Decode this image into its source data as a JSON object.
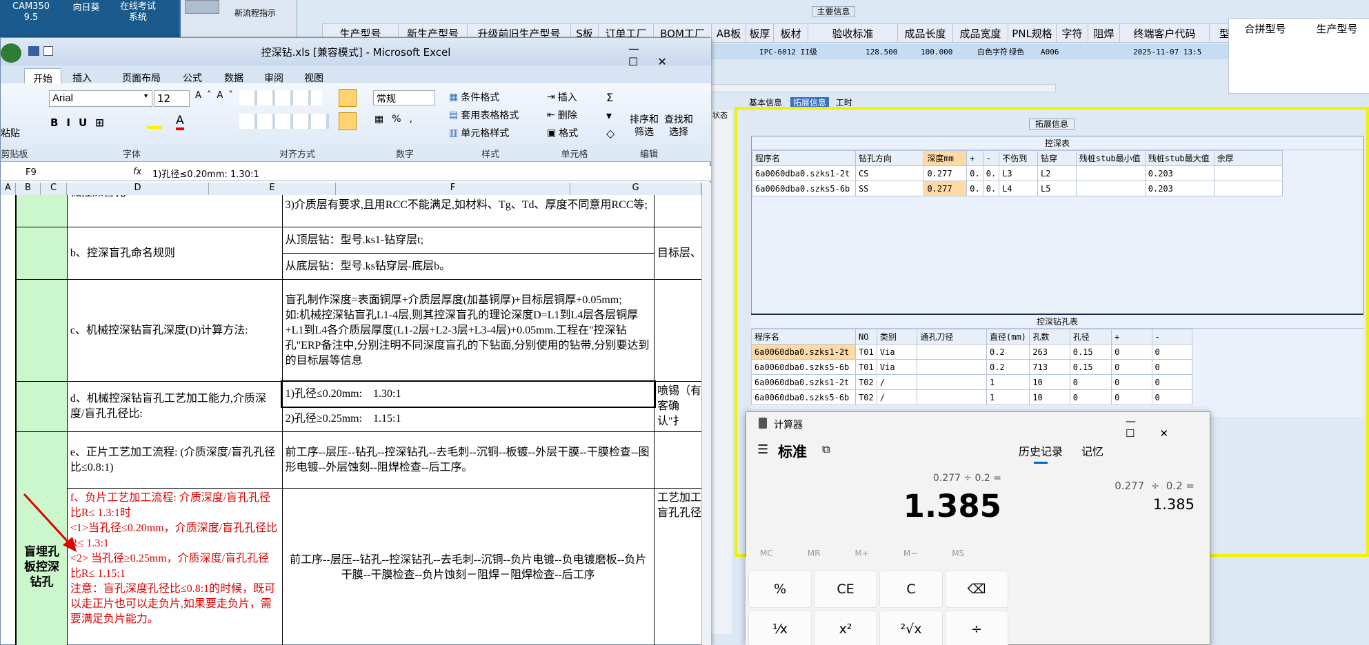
{
  "desktop": {
    "icons": [
      {
        "label": "CAM350\n9.5"
      },
      {
        "label": "向日葵"
      },
      {
        "label": "在线考试\n系统"
      }
    ],
    "new_flow_label": "新流程指示"
  },
  "erp": {
    "main_group": "主要信息",
    "headers": [
      "生产型号",
      "新生产型号",
      "升级前旧生产型号",
      "S板",
      "订单工厂",
      "BOM工厂",
      "AB板",
      "板厚",
      "板材",
      "验收标准",
      "成品长度",
      "成品宽度",
      "PNL规格",
      "字符",
      "阻焊",
      "终端客户代码",
      "型号创"
    ],
    "values": [
      "IPC-6012 II级",
      "128.500",
      "100.000",
      "白色字符",
      "绿色",
      "A006",
      "2025-11-07 13:5"
    ],
    "right_headers": [
      "合拼型号",
      "生产型号"
    ],
    "tabs": [
      "基本信息",
      "拓展信息",
      "工时"
    ],
    "side_label": "状态"
  },
  "panel": {
    "title": "拓展信息",
    "table1": {
      "caption": "控深表",
      "headers": [
        "程序名",
        "钻孔方向",
        "深度mm",
        "+",
        "-",
        "不伤到",
        "钻穿",
        "残桩stub最小值",
        "残桩stub最大值",
        "余厚"
      ],
      "rows": [
        [
          "6a0060dba0.szks1-2t",
          "CS",
          "0.277",
          "0.",
          "0.",
          "L3",
          "L2",
          "",
          "0.203",
          ""
        ],
        [
          "6a0060dba0.szks5-6b",
          "SS",
          "0.277",
          "0.",
          "0.",
          "L4",
          "L5",
          "",
          "0.203",
          ""
        ]
      ]
    },
    "table2": {
      "caption": "控深钻孔表",
      "headers": [
        "程序名",
        "NO",
        "类别",
        "通孔刀径",
        "直径(mm)",
        "孔数",
        "孔径",
        "+",
        "-"
      ],
      "rows": [
        [
          "6a0060dba0.szks1-2t",
          "T01",
          "Via",
          "",
          "0.2",
          "263",
          "0.15",
          "0",
          "0"
        ],
        [
          "6a0060dba0.szks5-6b",
          "T01",
          "Via",
          "",
          "0.2",
          "713",
          "0.15",
          "0",
          "0"
        ],
        [
          "6a0060dba0.szks1-2t",
          "T02",
          "/",
          "",
          "1",
          "10",
          "0",
          "0",
          "0"
        ],
        [
          "6a0060dba0.szks5-6b",
          "T02",
          "/",
          "",
          "1",
          "10",
          "0",
          "0",
          "0"
        ]
      ]
    }
  },
  "excel": {
    "title": "控深钻.xls  [兼容模式] - Microsoft Excel",
    "tabs": [
      "开始",
      "插入",
      "页面布局",
      "公式",
      "数据",
      "审阅",
      "视图"
    ],
    "clipboard": {
      "paste": "粘贴",
      "label": "剪贴板"
    },
    "font": {
      "name": "Arial",
      "size": "12",
      "label": "字体"
    },
    "align_label": "对齐方式",
    "number": {
      "format": "常规",
      "label": "数字"
    },
    "styles": {
      "cond": "条件格式",
      "table": "套用表格格式",
      "cell": "单元格样式",
      "label": "样式"
    },
    "cells": {
      "insert": "插入",
      "delete": "删除",
      "format": "格式",
      "label": "单元格"
    },
    "edit": {
      "sort": "排序和\n筛选",
      "find": "查找和\n选择",
      "label": "编辑"
    },
    "name_box": "F9",
    "formula": "1)孔径≤0.20mm:    1.30:1",
    "columns": [
      "A",
      "B",
      "C",
      "D",
      "E",
      "F",
      "G"
    ],
    "rows": [
      {
        "d": "械控深盲孔",
        "f": "3)介质层有要求,且用RCC不能满足,如材料、Tg、Td、厚度不同意用RCC等;",
        "g": ""
      },
      {
        "d": "b、控深盲孔命名规则",
        "f1": "从顶层钻：型号.ks1-钻穿层t;",
        "f2": "从底层钻：型号.ks钻穿层-底层b。",
        "g": "目标层、"
      },
      {
        "d": "c、机械控深钻盲孔深度(D)计算方法:",
        "f": "盲孔制作深度=表面铜厚+介质层厚度(加基铜厚)+目标层铜厚+0.05mm;\n如:机械控深钻盲孔L1-4层,则其控深盲孔的理论深度D=L1到L4层各层铜厚+L1到L4各介质层厚度(L1-2层+L2-3层+L3-4层)+0.05mm.工程在\"控深钻孔\"ERP备注中,分别注明不同深度盲孔的下钻面,分别使用的钻带,分别要达到的目标层等信息",
        "g": ""
      },
      {
        "d": "d、机械控深钻盲孔工艺加工能力,介质深度/盲孔孔径比:",
        "f1": "1)孔径≤0.20mm:    1.30:1",
        "f2": "2)孔径≥0.25mm:    1.15:1",
        "g": "喷锡（有客确认\"扌"
      },
      {
        "d": "e、正片工艺加工流程: (介质深度/盲孔孔径比≤0.8:1)",
        "f": "前工序--层压--钻孔--控深钻孔--去毛刺--沉铜--板镀--外层干膜--干膜检查--图形电镀--外层蚀刻--阻焊检查--后工序。",
        "g": ""
      },
      {
        "b": "盲埋孔板控深钻孔",
        "d": "f、负片工艺加工流程: 介质深度/盲孔孔径比R≤ 1.3:1时\n<1>当孔径≤0.20mm，介质深度/盲孔孔径比R≤ 1.3:1\n<2> 当孔径≥0.25mm，介质深度/盲孔孔径比R≤ 1.15:1\n注意：盲孔深度孔径比≤0.8:1的时候，既可以走正片也可以走负片,如果要走负片，需要满足负片能力。",
        "f": "前工序--层压--钻孔--控深钻孔--去毛刺--沉铜--负片电镀--负电镀磨板--负片干膜--干膜检查--负片蚀刻－阻焊－阻焊检查--后工序",
        "g": "工艺加工盲孔孔径"
      }
    ]
  },
  "calculator": {
    "title": "计算器",
    "mode": "标准",
    "tabs": [
      "历史记录",
      "记忆"
    ],
    "expression": "0.277 ÷ 0.2 =",
    "result": "1.385",
    "history_expr": "0.277  ÷  0.2 =",
    "history_result": "1.385",
    "mem_buttons": [
      "MC",
      "MR",
      "M+",
      "M−",
      "MS"
    ],
    "buttons": [
      "%",
      "CE",
      "C",
      "⌫",
      "¹⁄x",
      "x²",
      "²√x",
      "÷"
    ]
  }
}
